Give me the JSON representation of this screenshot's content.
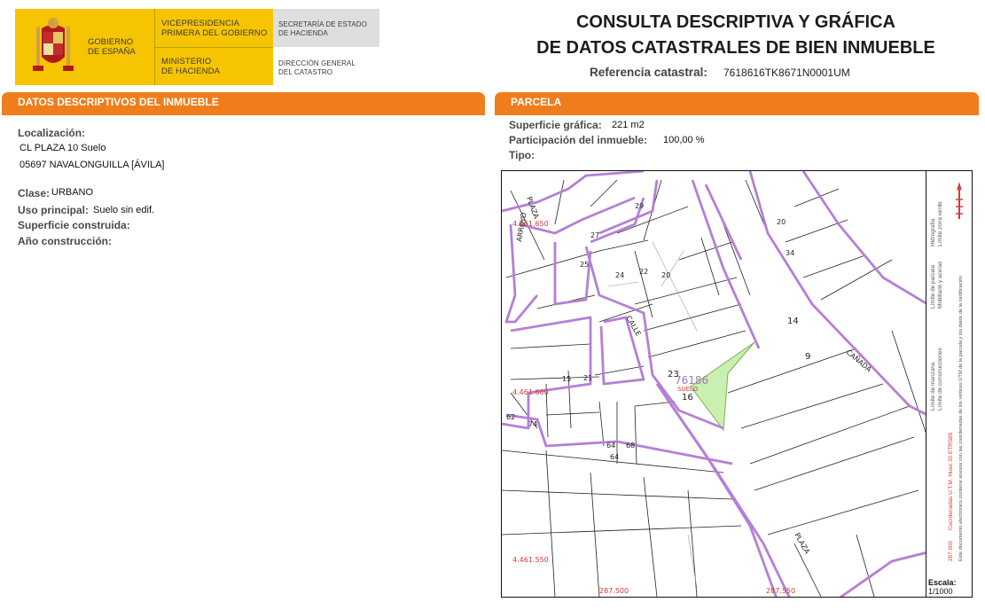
{
  "logo": {
    "gobierno": [
      "GOBIERNO",
      "DE ESPAÑA"
    ],
    "vice": [
      "VICEPRESIDENCIA",
      "PRIMERA DEL GOBIERNO"
    ],
    "ministerio": [
      "MINISTERIO",
      "DE HACIENDA"
    ],
    "secretaria": [
      "SECRETARÍA DE ESTADO",
      "DE HACIENDA"
    ],
    "direccion": [
      "DIRECCIÓN GENERAL",
      "DEL CATASTRO"
    ]
  },
  "title": [
    "CONSULTA DESCRIPTIVA Y GRÁFICA",
    "DE DATOS CATASTRALES DE BIEN INMUEBLE"
  ],
  "referencia": {
    "label": "Referencia catastral:",
    "value": "7618616TK8671N0001UM"
  },
  "datos": {
    "header": "DATOS DESCRIPTIVOS DEL INMUEBLE",
    "localizacion_label": "Localización:",
    "localizacion_1": "CL PLAZA 10 Suelo",
    "localizacion_2": "05697 NAVALONGUILLA [ÁVILA]",
    "clase_label": "Clase:",
    "clase_value": "URBANO",
    "uso_label": "Uso principal:",
    "uso_value": "Suelo sin edif.",
    "superficie_label": "Superficie construida:",
    "anio_label": "Año construcción:"
  },
  "parcela": {
    "header": "PARCELA",
    "superficie_label": "Superficie gráfica:",
    "superficie_value": "221 m2",
    "participacion_label": "Participación del inmueble:",
    "participacion_value": "100,00 %",
    "tipo_label": "Tipo:"
  },
  "map": {
    "coords": {
      "y1": "4.461.650",
      "y2": "4.461.600",
      "y3": "4.461.550",
      "x1": "287.500",
      "x2": "287.550"
    },
    "parcel_id": "76186",
    "parcel_label": "SUELO",
    "streets": {
      "plaza_top": "PLAZA",
      "plaza_bottom": "PLAZA",
      "calle": "CALLE",
      "cañada": "CAÑADA",
      "arroyo": "ARROYO"
    },
    "numbers": [
      "30",
      "2",
      "29",
      "27",
      "26",
      "25",
      "22",
      "20",
      "24",
      "23",
      "21",
      "18",
      "13",
      "19",
      "11",
      "14",
      "9",
      "7",
      "10",
      "17",
      "15",
      "16",
      "17",
      "74",
      "72",
      "70",
      "68",
      "64",
      "62",
      "8",
      "6",
      "4",
      "3",
      "2",
      "1",
      "08",
      "09",
      "34",
      "32",
      "30",
      "28",
      "26",
      "24",
      "22",
      "20",
      "44",
      "42",
      "40",
      "38",
      "36",
      "34",
      "78",
      "80",
      "2",
      "66",
      "21",
      "19"
    ]
  },
  "legend": {
    "items": [
      "Límite de manzana",
      "Límite de construcciones",
      "Límite de parcela",
      "Mobiliario y aceras",
      "Hidrografía",
      "Límite zona verde"
    ],
    "coords_note": "Coordenadas U.T.M. Huso 30 ETRS89",
    "coords_num": "287.600",
    "note": "Este documento electrónico contiene anexos con las coordenadas de los vértices UTM de la parcela y los datos de la certificación",
    "escala_label": "Escala:",
    "escala_value": "1/1000"
  },
  "colors": {
    "accent": "#f07d1b",
    "logo_yellow": "#f6c400",
    "manzana": "#b57fd6",
    "parcel": "#c9f0b0",
    "coord": "#d33a3a"
  }
}
